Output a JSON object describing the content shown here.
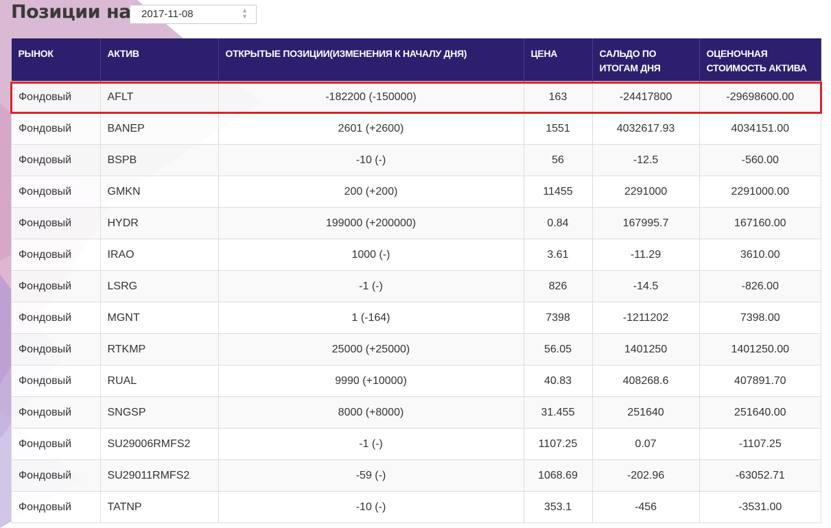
{
  "header": {
    "title": "Позиции на",
    "date": "2017-11-08"
  },
  "table": {
    "columns": [
      "РЫНОК",
      "АКТИВ",
      "ОТКРЫТЫЕ ПОЗИЦИИ(ИЗМЕНЕНИЯ К НАЧАЛУ ДНЯ)",
      "ЦЕНА",
      "САЛЬДО ПО ИТОГАМ ДНЯ",
      "ОЦЕНОЧНАЯ СТОИМОСТЬ АКТИВА"
    ],
    "rows": [
      [
        "Фондовый",
        "AFLT",
        "-182200 (-150000)",
        "163",
        "-24417800",
        "-29698600.00"
      ],
      [
        "Фондовый",
        "BANEP",
        "2601 (+2600)",
        "1551",
        "4032617.93",
        "4034151.00"
      ],
      [
        "Фондовый",
        "BSPB",
        "-10 (-)",
        "56",
        "-12.5",
        "-560.00"
      ],
      [
        "Фондовый",
        "GMKN",
        "200 (+200)",
        "11455",
        "2291000",
        "2291000.00"
      ],
      [
        "Фондовый",
        "HYDR",
        "199000 (+200000)",
        "0.84",
        "167995.7",
        "167160.00"
      ],
      [
        "Фондовый",
        "IRAO",
        "1000 (-)",
        "3.61",
        "-11.29",
        "3610.00"
      ],
      [
        "Фондовый",
        "LSRG",
        "-1 (-)",
        "826",
        "-14.5",
        "-826.00"
      ],
      [
        "Фондовый",
        "MGNT",
        "1 (-164)",
        "7398",
        "-1211202",
        "7398.00"
      ],
      [
        "Фондовый",
        "RTKMP",
        "25000 (+25000)",
        "56.05",
        "1401250",
        "1401250.00"
      ],
      [
        "Фондовый",
        "RUAL",
        "9990 (+10000)",
        "40.83",
        "408268.6",
        "407891.70"
      ],
      [
        "Фондовый",
        "SNGSP",
        "8000 (+8000)",
        "31.455",
        "251640",
        "251640.00"
      ],
      [
        "Фондовый",
        "SU29006RMFS2",
        "-1 (-)",
        "1107.25",
        "0.07",
        "-1107.25"
      ],
      [
        "Фондовый",
        "SU29011RMFS2",
        "-59 (-)",
        "1068.69",
        "-202.96",
        "-63052.71"
      ],
      [
        "Фондовый",
        "TATNP",
        "-10 (-)",
        "353.1",
        "-456",
        "-3531.00"
      ]
    ]
  }
}
